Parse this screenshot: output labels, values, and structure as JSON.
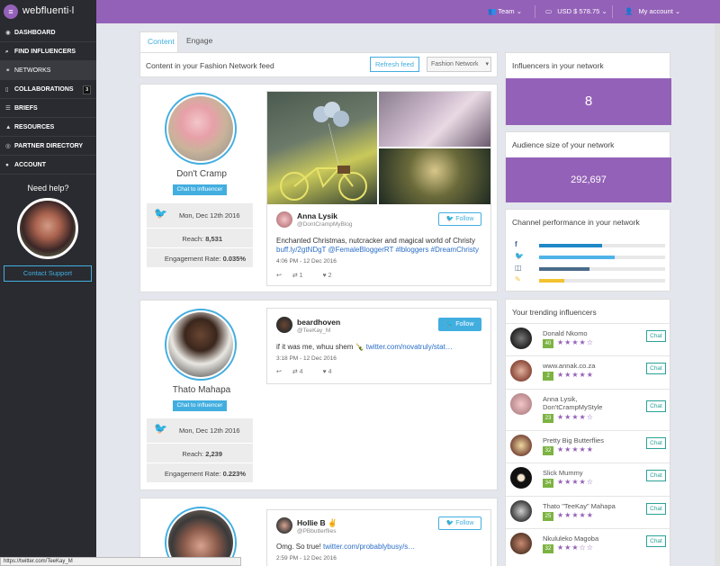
{
  "app": {
    "logo": "webfluenti∙l",
    "menu_icon": "hamburger-icon"
  },
  "topbar": {
    "team": "Team",
    "balance": "USD $ 578.75",
    "account": "My account"
  },
  "sidebar": {
    "items": [
      {
        "label": "DASHBOARD",
        "icon": "dashboard-icon"
      },
      {
        "label": "FIND INFLUENCERS",
        "icon": "search-icon"
      },
      {
        "label": "NETWORKS",
        "icon": "network-icon"
      },
      {
        "label": "COLLABORATIONS",
        "icon": "collaboration-icon",
        "count": "3"
      },
      {
        "label": "BRIEFS",
        "icon": "briefs-icon"
      },
      {
        "label": "RESOURCES",
        "icon": "resources-icon"
      },
      {
        "label": "PARTNER DIRECTORY",
        "icon": "eye-icon"
      },
      {
        "label": "ACCOUNT",
        "icon": "user-icon"
      }
    ],
    "help_title": "Need help?",
    "contact_label": "Contact Support"
  },
  "tabs": [
    "Content",
    "Engage"
  ],
  "feed": {
    "title": "Content in your Fashion Network feed",
    "refresh_label": "Refresh feed",
    "network_select": "Fashion Network"
  },
  "posts": [
    {
      "influencer": "Don't Cramp",
      "chat_label": "Chat to influencer",
      "date": "Mon, Dec 12th 2016",
      "reach_label": "Reach:",
      "reach": "8,531",
      "engagement_label": "Engagement Rate:",
      "engagement": "0.035%",
      "tweet": {
        "name": "Anna Lysik",
        "handle": "@DontCrampMyBlog",
        "follow": "Follow",
        "text": "Enchanted Christmas, nutcracker and magical world of Christy",
        "link": "buff.ly/2gtNDgT @FemaleBloggerRT #lbloggers #DreamChristy",
        "time": "4:06 PM - 12 Dec 2016",
        "retweets": "1",
        "likes": "2"
      }
    },
    {
      "influencer": "Thato Mahapa",
      "chat_label": "Chat to influencer",
      "date": "Mon, Dec 12th 2016",
      "reach_label": "Reach:",
      "reach": "2,239",
      "engagement_label": "Engagement Rate:",
      "engagement": "0.223%",
      "tweet": {
        "name": "beardhoven",
        "handle": "@TeeKay_M",
        "follow": "Follow",
        "text": "if it was me, whuu shem 🍾",
        "link": "twitter.com/novatruly/stat…",
        "time": "3:18 PM - 12 Dec 2016",
        "retweets": "4",
        "likes": "4"
      }
    },
    {
      "tweet": {
        "name": "Hollie B ✌️",
        "handle": "@PBbutterflies",
        "follow": "Follow",
        "text": "Omg. So true!",
        "link": "twitter.com/probablybusy/s…",
        "time": "2:59 PM - 12 Dec 2016"
      }
    }
  ],
  "panels": {
    "influencers_title": "Influencers in your network",
    "influencers_count": "8",
    "audience_title": "Audience size of your network",
    "audience_size": "292,697",
    "channel_title": "Channel performance in your network",
    "channels": [
      {
        "icon": "facebook-icon",
        "color": "#1e88c7",
        "value": 0.5
      },
      {
        "icon": "twitter-icon",
        "color": "#4fb3e8",
        "value": 0.6
      },
      {
        "icon": "instagram-icon",
        "color": "#4a6b8a",
        "value": 0.4
      },
      {
        "icon": "blog-icon",
        "color": "#f2c230",
        "value": 0.2
      }
    ],
    "trending_title": "Your trending influencers",
    "chat_label": "Chat",
    "trending": [
      {
        "name": "Donald Nkomo",
        "score": "40",
        "stars": 4
      },
      {
        "name": "www.annak.co.za",
        "score": "2",
        "stars": 5
      },
      {
        "name": "Anna Lysik,",
        "name2": "Don'tCrampMyStyle",
        "score": "23",
        "stars": 4
      },
      {
        "name": "Pretty Big Butterflies",
        "score": "32",
        "stars": 5
      },
      {
        "name": "Slick Mummy",
        "score": "34",
        "stars": 4
      },
      {
        "name": "Thato \"TeeKay\" Mahapa",
        "score": "25",
        "stars": 5
      },
      {
        "name": "Nkululeko Magoba",
        "score": "32",
        "stars": 3
      }
    ]
  },
  "statusbar": "https://twitter.com/TeeKay_M",
  "colors": {
    "accent": "#9461b8",
    "twitter": "#42aee0",
    "sidebar": "#2a2b30"
  }
}
